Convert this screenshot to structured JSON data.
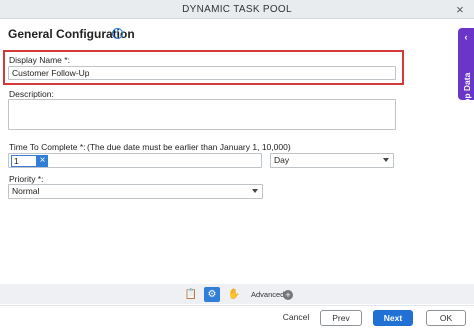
{
  "window": {
    "title": "DYNAMIC TASK POOL",
    "close_glyph": "×"
  },
  "section": {
    "title": "General Configuration",
    "info_glyph": "i"
  },
  "fields": {
    "display_name": {
      "label": "Display Name *:",
      "value": "Customer Follow-Up"
    },
    "description": {
      "label": "Description:",
      "value": ""
    },
    "time_to_complete": {
      "label": "Time To Complete *:",
      "hint": "(The due date must be earlier than January 1, 10,000)",
      "value": "1",
      "clear_glyph": "×",
      "unit": "Day"
    },
    "priority": {
      "label": "Priority *:",
      "value": "Normal"
    }
  },
  "app_data_tab": {
    "label": "App Data",
    "chevron": "‹"
  },
  "toolbar": {
    "icons": [
      {
        "name": "clipboard-icon",
        "glyph": "📋"
      },
      {
        "name": "gear-icon",
        "glyph": "⚙"
      },
      {
        "name": "hand-icon",
        "glyph": "✋"
      }
    ],
    "advanced_label": "Advanced",
    "plus_glyph": "+"
  },
  "footer": {
    "cancel": "Cancel",
    "prev": "Prev",
    "next": "Next",
    "ok": "OK"
  },
  "colors": {
    "accent": "#2170d6",
    "highlight": "#d23a3a",
    "app_data_tab": "#6a35c8"
  }
}
